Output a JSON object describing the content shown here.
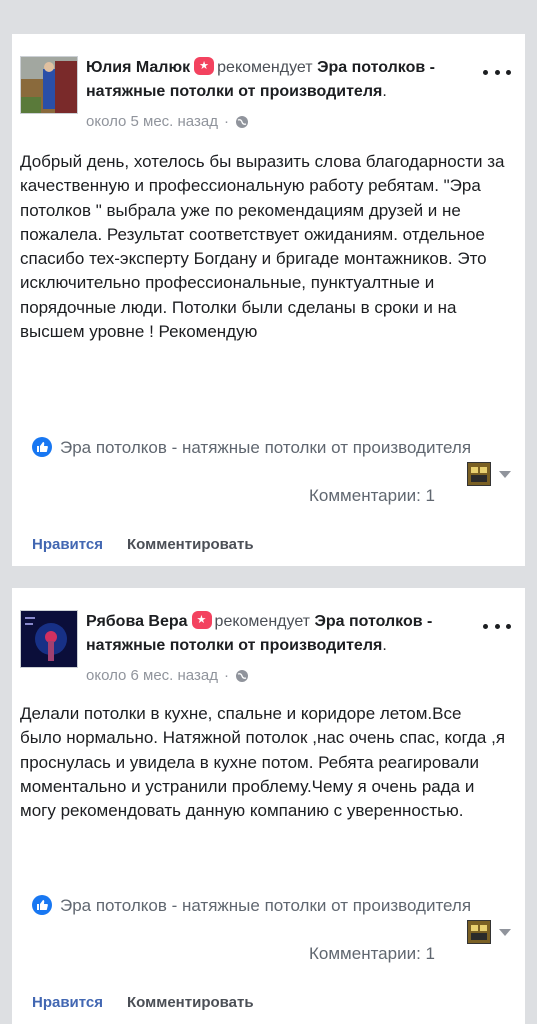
{
  "posts": [
    {
      "author": "Юлия Малюк",
      "verb": "рекомендует",
      "page": "Эра потолков - натяжные потолки от производителя",
      "time": "около 5 мес. назад",
      "text": "Добрый день, хотелось бы выразить слова благодарности за качественную и профессиональную работу ребятам. \"Эра потолков \" выбрала уже по рекомендациям друзей и не пожалела. Результат соответствует ожиданиям. отдельное спасибо тех-эксперту Богдану и бригаде монтажников. Это исключительно профессиональные, пунктуалтные и порядочные люди. Потолки были сделаны в сроки и на высшем уровне ! Рекомендую",
      "liked_by": "Эра потолков - натяжные потолки от производителя",
      "comments": "Комментарии: 1",
      "like_label": "Нравится",
      "comment_label": "Комментировать"
    },
    {
      "author": "Рябова Вера",
      "verb": "рекомендует",
      "page": "Эра потолков - натяжные потолки от производителя",
      "time": "около 6 мес. назад",
      "text": "Делали потолки в кухне, спальне и коридоре летом.Все было нормально. Натяжной потолок ,нас очень спас, когда ,я проснулась и увидела в кухне потом. Ребята реагировали моментально и устранили проблему.Чему я очень рада и могу рекомендовать данную компанию с уверенностью.",
      "liked_by": "Эра потолков - натяжные потолки от производителя",
      "comments": "Комментарии: 1",
      "like_label": "Нравится",
      "comment_label": "Комментировать"
    }
  ],
  "colors": {
    "accent": "#4267b2",
    "recommend_badge": "#f3425f",
    "like_icon": "#1877f2",
    "background": "#dddfe2"
  },
  "icons": [
    "recommend-badge-icon",
    "globe-icon",
    "more-options-icon",
    "like-icon",
    "caret-down-icon"
  ]
}
